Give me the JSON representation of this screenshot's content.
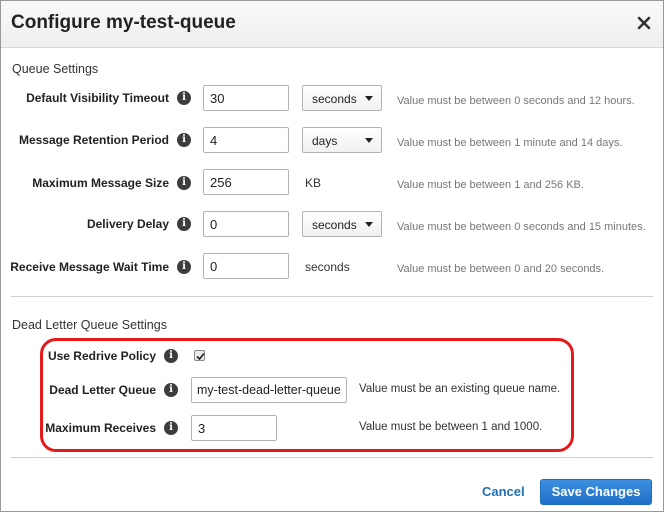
{
  "dialog": {
    "title": "Configure my-test-queue"
  },
  "queue_settings": {
    "heading": "Queue Settings",
    "rows": [
      {
        "label": "Default Visibility Timeout",
        "value": "30",
        "unit_select": "seconds",
        "hint": "Value must be between 0 seconds and 12 hours."
      },
      {
        "label": "Message Retention Period",
        "value": "4",
        "unit_select": "days",
        "hint": "Value must be between 1 minute and 14 days."
      },
      {
        "label": "Maximum Message Size",
        "value": "256",
        "unit_text": "KB",
        "hint": "Value must be between 1 and 256 KB."
      },
      {
        "label": "Delivery Delay",
        "value": "0",
        "unit_select": "seconds",
        "hint": "Value must be between 0 seconds and 15 minutes."
      },
      {
        "label": "Receive Message Wait Time",
        "value": "0",
        "unit_text": "seconds",
        "hint": "Value must be between 0 and 20 seconds."
      }
    ]
  },
  "dead_letter": {
    "heading": "Dead Letter Queue Settings",
    "use_redrive_label": "Use Redrive Policy",
    "use_redrive_checked": true,
    "dlq_label": "Dead Letter Queue",
    "dlq_value": "my-test-dead-letter-queue",
    "dlq_hint": "Value must be an existing queue name.",
    "max_receives_label": "Maximum Receives",
    "max_receives_value": "3",
    "max_receives_hint": "Value must be between 1 and 1000."
  },
  "footer": {
    "cancel_label": "Cancel",
    "save_label": "Save Changes"
  },
  "icons": {
    "info": "info-icon",
    "close": "close-icon",
    "caret": "chevron-down-icon"
  },
  "colors": {
    "highlight": "#e51a1a",
    "primary_button": "#1f6fc8",
    "link": "#1f6fb8"
  }
}
